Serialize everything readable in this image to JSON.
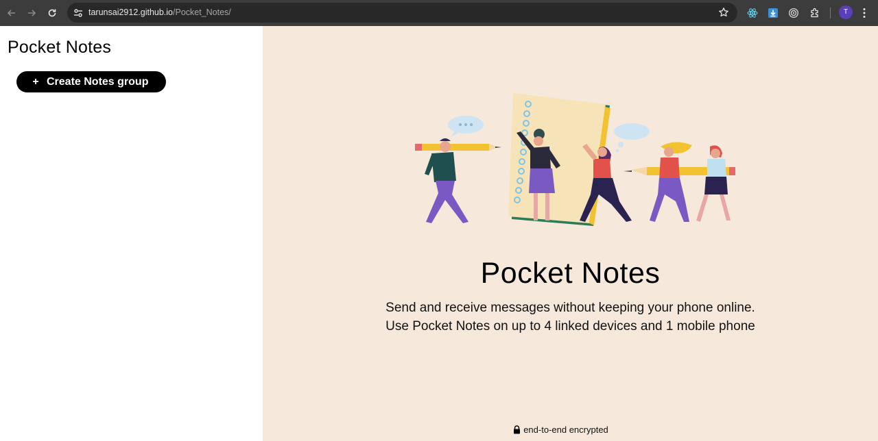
{
  "browser": {
    "url_host": "tarunsai2912.github.io",
    "url_path": "/Pocket_Notes/",
    "profile_initial": "T",
    "icons": [
      "back-arrow-icon",
      "forward-arrow-icon",
      "reload-icon",
      "site-settings-icon",
      "bookmark-star-icon",
      "react-devtools-icon",
      "download-icon",
      "circle-target-icon",
      "extensions-puzzle-icon",
      "menu-dots-icon"
    ]
  },
  "sidebar": {
    "title": "Pocket Notes",
    "create_button": {
      "icon": "+",
      "label": "Create Notes group"
    }
  },
  "main": {
    "title": "Pocket Notes",
    "description_line1": "Send and receive messages without keeping your phone online.",
    "description_line2": "Use Pocket Notes on up to 4 linked devices and 1 mobile phone",
    "footer_note": "end-to-end encrypted",
    "illustration": "people-with-pencils-and-notebook-illustration"
  },
  "colors": {
    "main_background": "#f6e9dc",
    "button_background": "#000000",
    "chrome_background": "#3c3c3c"
  }
}
